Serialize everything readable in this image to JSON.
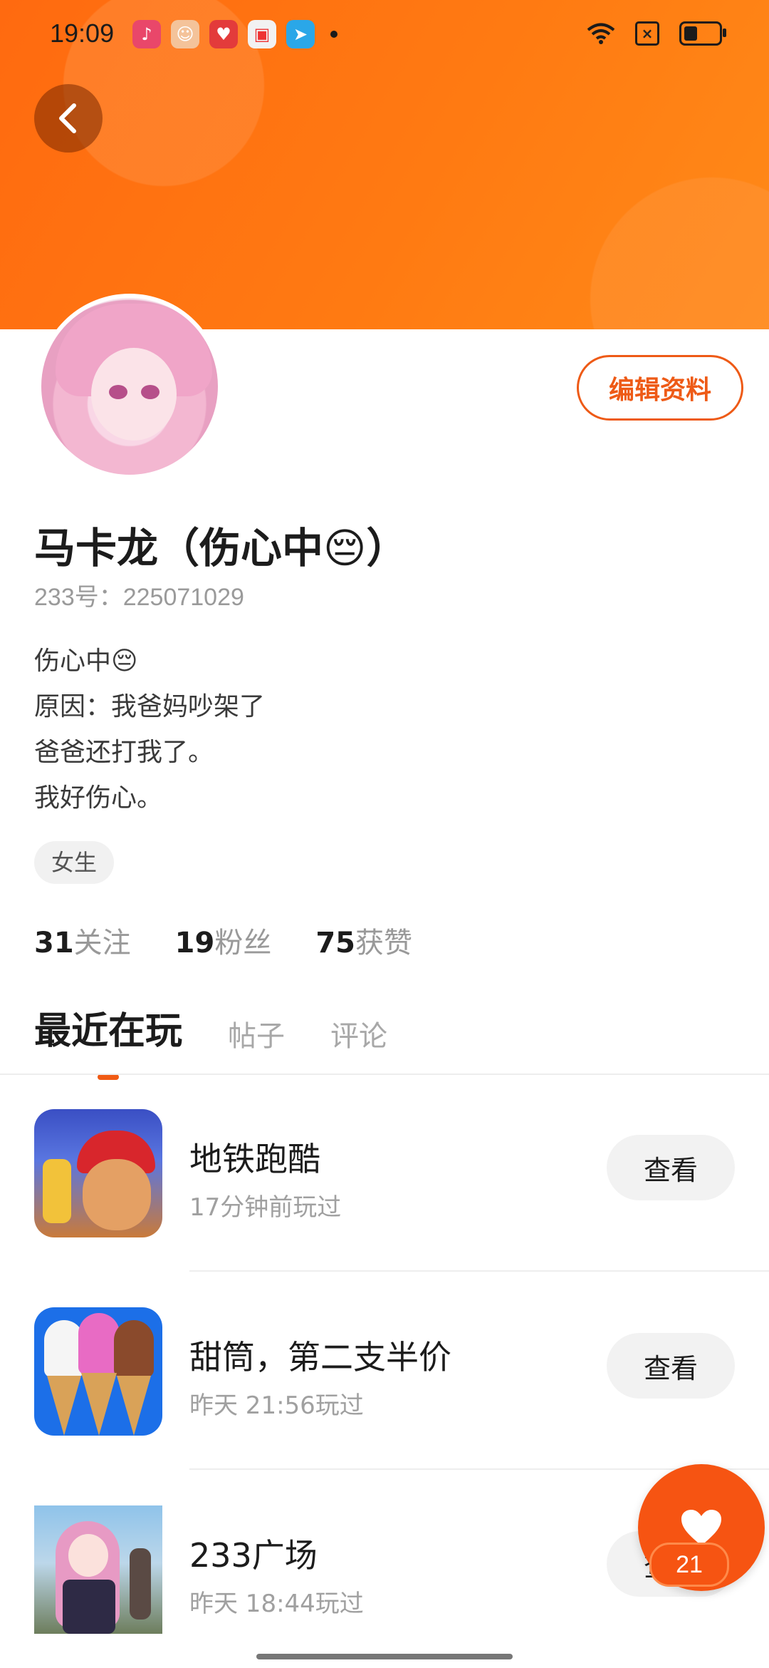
{
  "status_bar": {
    "time": "19:09"
  },
  "header": {
    "back_label": ""
  },
  "profile": {
    "name": "马卡龙（伤心中😔）",
    "uid": "233号：225071029",
    "bio": [
      "伤心中😔",
      "原因：我爸妈吵架了",
      "爸爸还打我了。",
      "我好伤心。"
    ],
    "tag": "女生",
    "edit_label": "编辑资料"
  },
  "stats": [
    {
      "value": "31",
      "label": "关注"
    },
    {
      "value": "19",
      "label": "粉丝"
    },
    {
      "value": "75",
      "label": "获赞"
    }
  ],
  "tabs": [
    {
      "label": "最近在玩",
      "active": true
    },
    {
      "label": "帖子",
      "active": false
    },
    {
      "label": "评论",
      "active": false
    }
  ],
  "games": [
    {
      "title": "地铁跑酷",
      "time": "17分钟前玩过",
      "button": "查看",
      "icon": "subway-surfers-icon"
    },
    {
      "title": "甜筒，第二支半价",
      "time": "昨天 21:56玩过",
      "button": "查看",
      "icon": "ice-cream-cone-icon"
    },
    {
      "title": "233广场",
      "time": "昨天 18:44玩过",
      "button": "查看",
      "icon": "anime-girl-icon"
    }
  ],
  "like_fab": {
    "count": "21",
    "icon": "heart-icon"
  },
  "colors": {
    "accent": "#f05a14",
    "banner": "#ff7412"
  }
}
